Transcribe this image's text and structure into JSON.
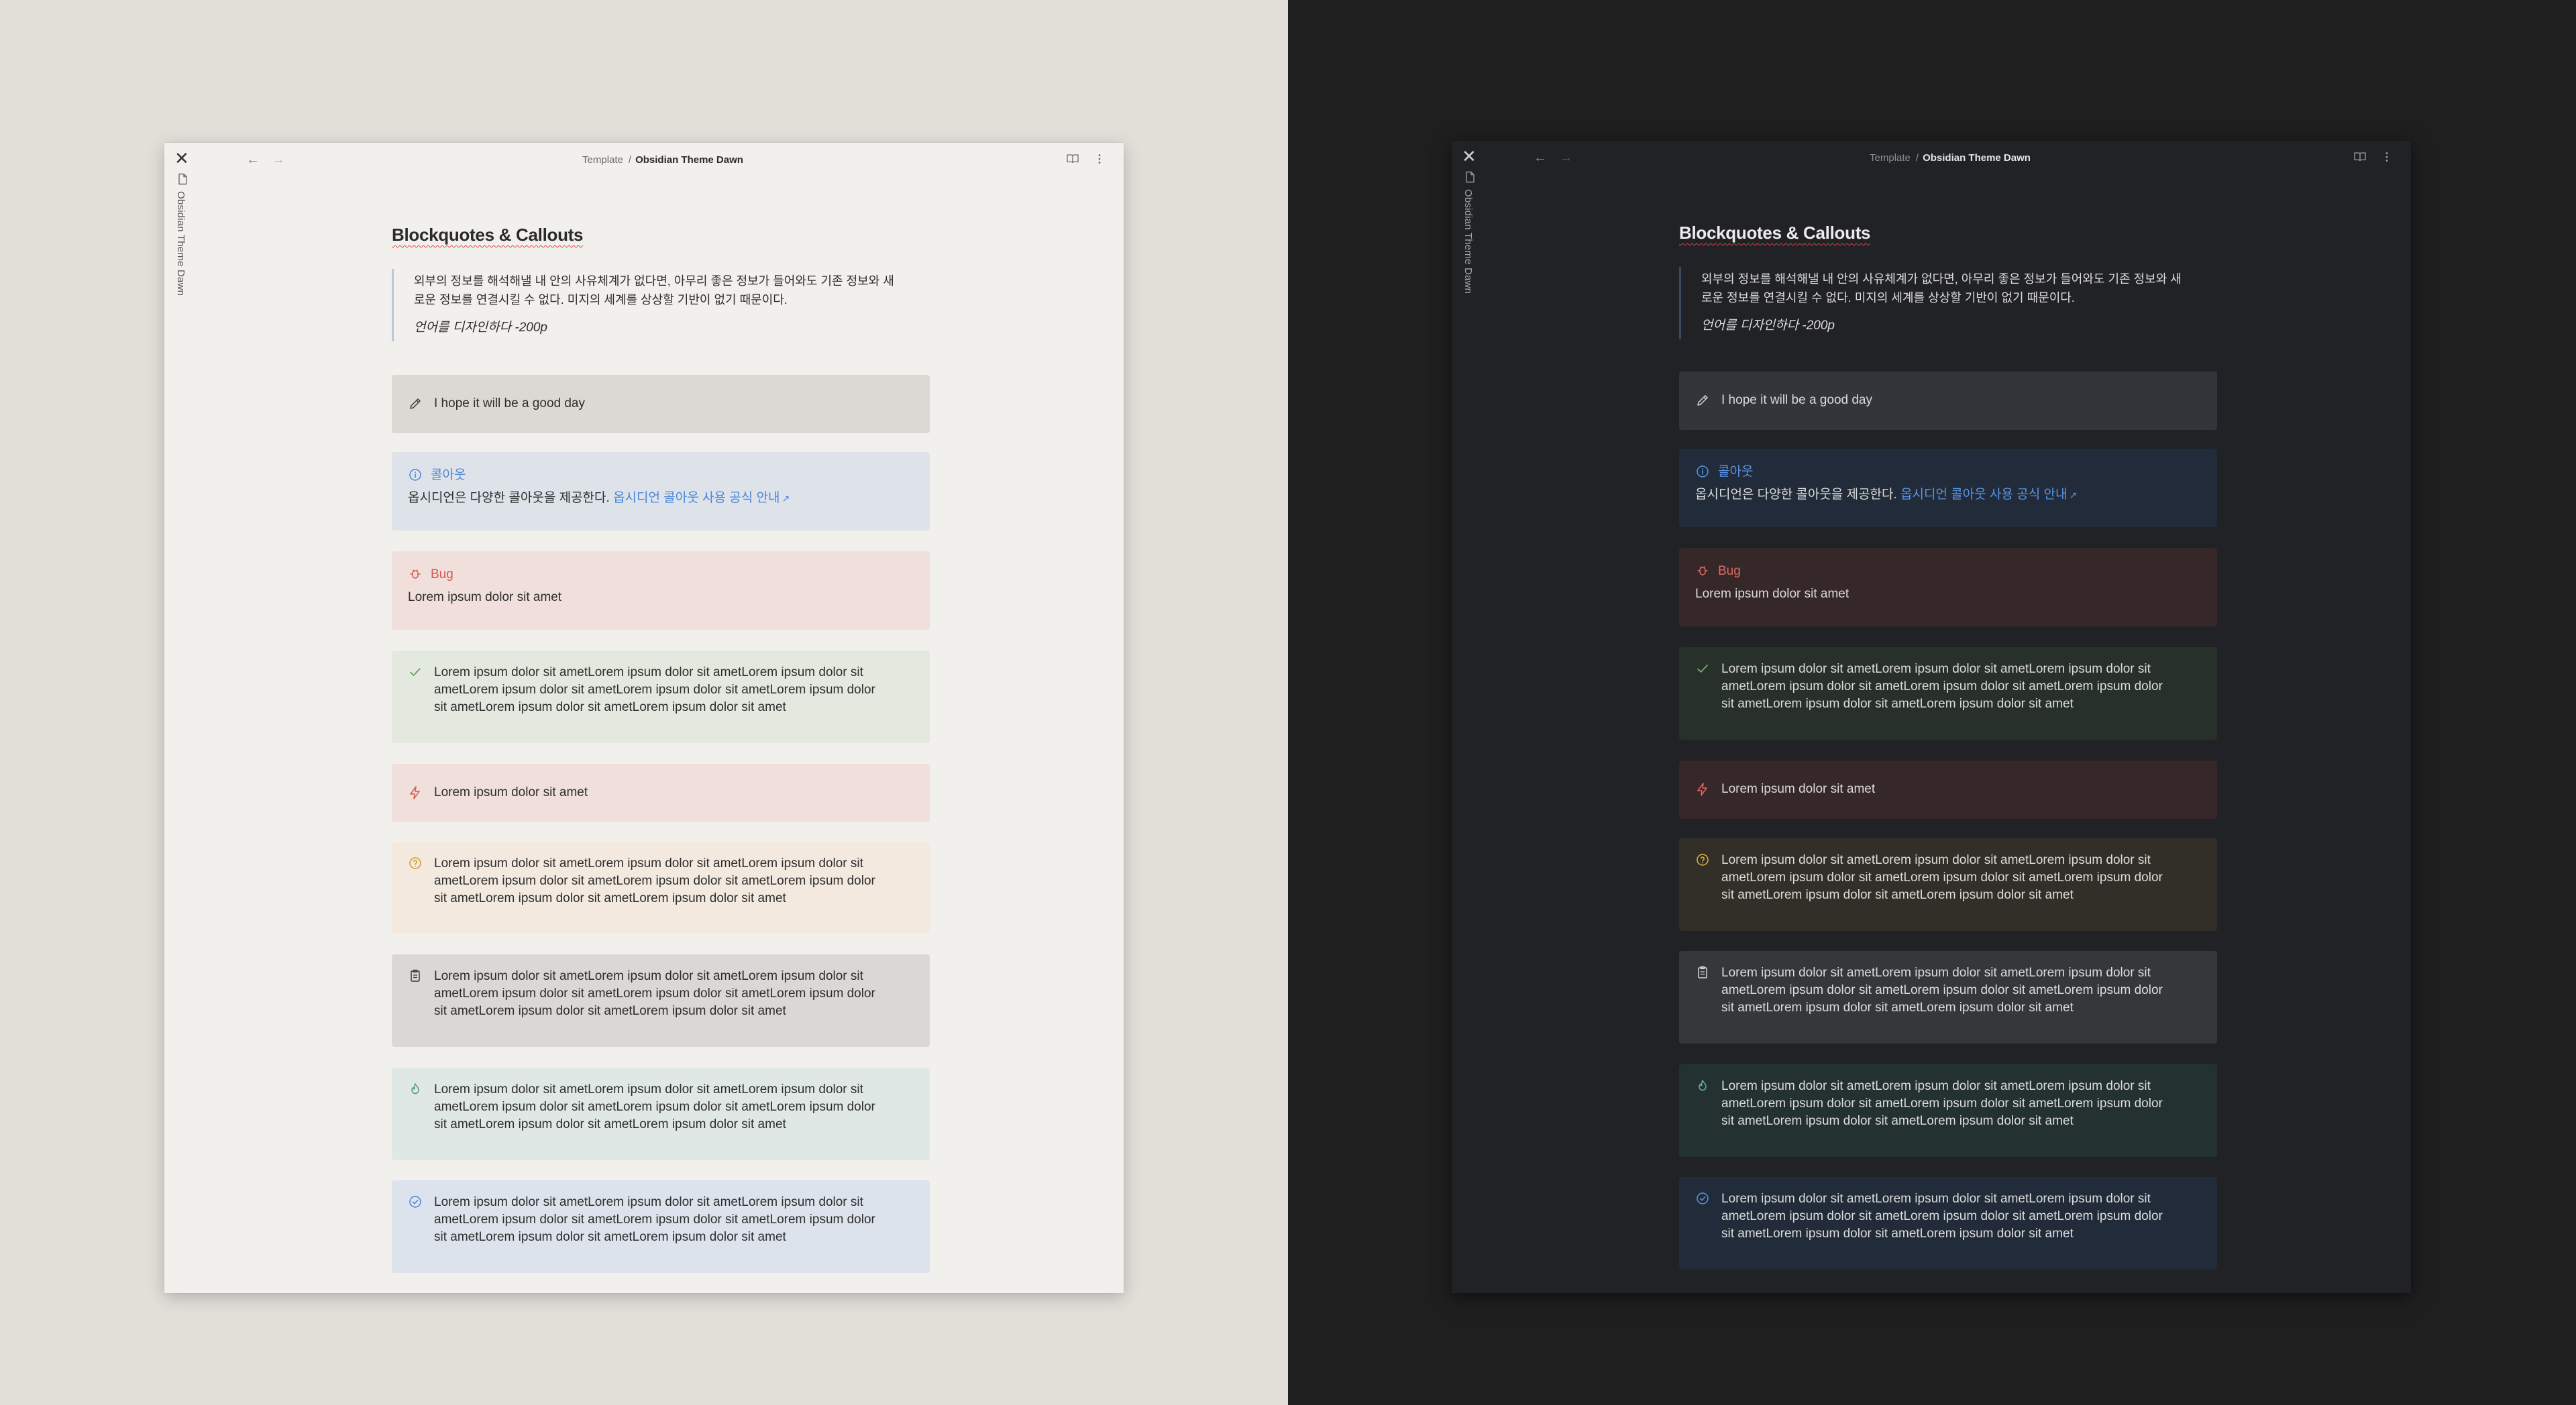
{
  "window": {
    "ribbon_title": "Obsidian Theme Dawn",
    "close_glyph": "✕",
    "nav_back": "←",
    "nav_forward": "→"
  },
  "breadcrumb": {
    "parent": "Template",
    "separator": "/",
    "current": "Obsidian Theme Dawn"
  },
  "page": {
    "title": "Blockquotes & Callouts",
    "blockquote": {
      "text": "외부의 정보를 해석해낼 내 안의 사유체계가 없다면, 아무리 좋은 정보가 들어와도 기존 정보와 새로운 정보를 연결시킬 수 없다. 미지의 세계를 상상할 기반이 없기 때문이다.",
      "line1": "외부의 정보를 해석해낼 내 안의 사유체계가 없다면, 아무리 좋은 정보가 들어와도 기존 정보와 새",
      "line2": "로운 정보를 연결시킬 수 없다. 미지의 세계를 상상할 기반이 없기 때문이다.",
      "citation": "언어를 디자인하다 -200p"
    },
    "callouts": {
      "note": {
        "icon": "pencil-icon",
        "text": "I hope it will be a good day"
      },
      "info": {
        "icon": "info-circle-icon",
        "title": "콜아웃",
        "body": "옵시디언은 다양한 콜아웃을 제공한다.",
        "link": "옵시디언 콜아웃 사용 공식 안내",
        "link_icon": "external-link-icon"
      },
      "bug": {
        "icon": "bug-icon",
        "title": "Bug",
        "body": "Lorem ipsum dolor sit amet"
      },
      "success": {
        "icon": "check-icon",
        "l1": "Lorem ipsum dolor sit ametLorem ipsum dolor sit ametLorem ipsum dolor sit",
        "l2": "ametLorem ipsum dolor sit ametLorem ipsum dolor sit ametLorem ipsum dolor",
        "l3": "sit ametLorem ipsum dolor sit ametLorem ipsum dolor sit amet"
      },
      "danger": {
        "icon": "zap-icon",
        "text": "Lorem ipsum dolor sit amet"
      },
      "question": {
        "icon": "help-circle-icon",
        "l1": "Lorem ipsum dolor sit ametLorem ipsum dolor sit ametLorem ipsum dolor sit",
        "l2": "ametLorem ipsum dolor sit ametLorem ipsum dolor sit ametLorem ipsum dolor",
        "l3": "sit ametLorem ipsum dolor sit ametLorem ipsum dolor sit amet"
      },
      "abstract": {
        "icon": "clipboard-icon",
        "l1": "Lorem ipsum dolor sit ametLorem ipsum dolor sit ametLorem ipsum dolor sit",
        "l2": "ametLorem ipsum dolor sit ametLorem ipsum dolor sit ametLorem ipsum dolor",
        "l3": "sit ametLorem ipsum dolor sit ametLorem ipsum dolor sit amet"
      },
      "tip": {
        "icon": "flame-icon",
        "l1": "Lorem ipsum dolor sit ametLorem ipsum dolor sit ametLorem ipsum dolor sit",
        "l2": "ametLorem ipsum dolor sit ametLorem ipsum dolor sit ametLorem ipsum dolor",
        "l3": "sit ametLorem ipsum dolor sit ametLorem ipsum dolor sit amet"
      },
      "done": {
        "icon": "check-circle-icon",
        "l1": "Lorem ipsum dolor sit ametLorem ipsum dolor sit ametLorem ipsum dolor sit",
        "l2": "ametLorem ipsum dolor sit ametLorem ipsum dolor sit ametLorem ipsum dolor",
        "l3": "sit ametLorem ipsum dolor sit ametLorem ipsum dolor sit amet"
      }
    }
  },
  "colors": {
    "light_background": "#e2dfd9",
    "light_window": "#f2f0ec",
    "dark_background": "#1f1f1f",
    "dark_window": "#212226",
    "accent_blue": "#4a86d9",
    "bug_red": "#d5574f",
    "success_green": "#6b9a5c",
    "question_amber": "#d49a2a",
    "tip_teal": "#4e9b96"
  }
}
